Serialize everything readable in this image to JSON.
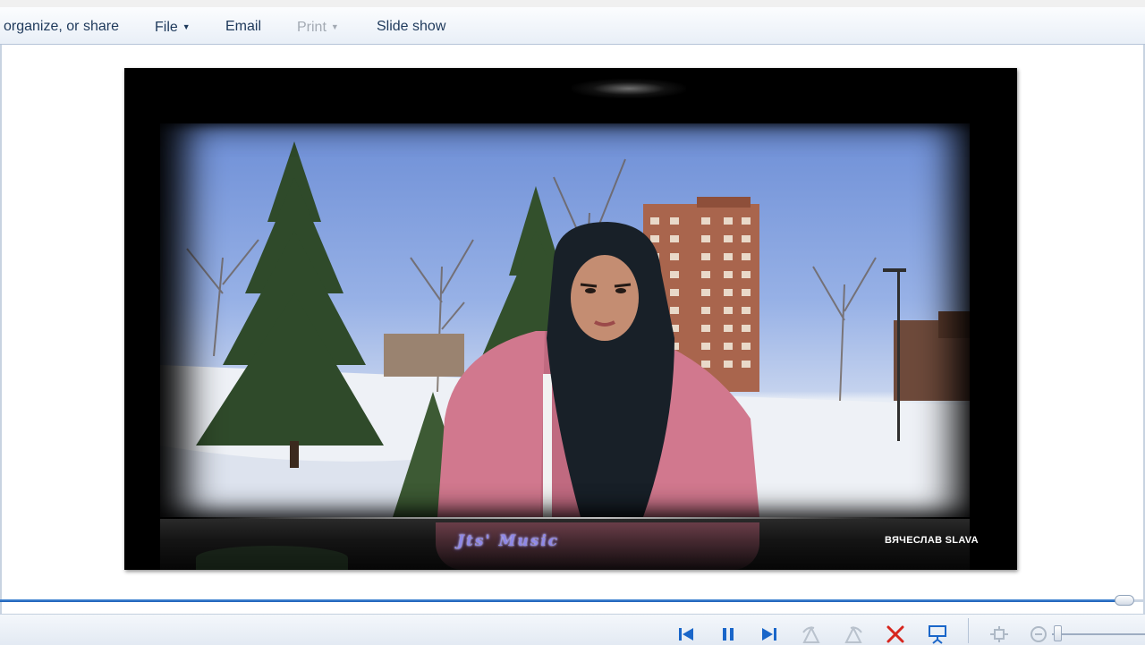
{
  "menubar": {
    "items": [
      {
        "label": "organize, or share",
        "enabled": true,
        "has_caret": false
      },
      {
        "label": "File",
        "enabled": true,
        "has_caret": true
      },
      {
        "label": "Email",
        "enabled": true,
        "has_caret": false
      },
      {
        "label": "Print",
        "enabled": false,
        "has_caret": true
      },
      {
        "label": "Slide show",
        "enabled": true,
        "has_caret": false
      }
    ]
  },
  "viewer": {
    "watermark_script": "Jts' Music",
    "credit": "ВЯЧЕСЛАВ SLAVA"
  },
  "seekbar": {
    "progress_fraction": 0.98
  },
  "controls": {
    "items": [
      {
        "name": "previous-icon",
        "enabled": true
      },
      {
        "name": "pause-icon",
        "enabled": true
      },
      {
        "name": "next-icon",
        "enabled": true
      },
      {
        "name": "rotate-counterclockwise-icon",
        "enabled": false
      },
      {
        "name": "rotate-clockwise-icon",
        "enabled": false
      },
      {
        "name": "delete-icon",
        "enabled": true
      },
      {
        "name": "slideshow-icon",
        "enabled": true
      },
      {
        "name": "actual-size-icon",
        "enabled": false
      },
      {
        "name": "zoom-out-icon",
        "enabled": false
      }
    ],
    "zoom_level_fraction": 0.05
  },
  "colors": {
    "accent": "#1b5fb6",
    "menu_text": "#1e395b",
    "disabled_text": "#a3aab3",
    "delete_red": "#d7261e",
    "playback_blue": "#1a66c9",
    "watermark": "#8f88e8"
  }
}
